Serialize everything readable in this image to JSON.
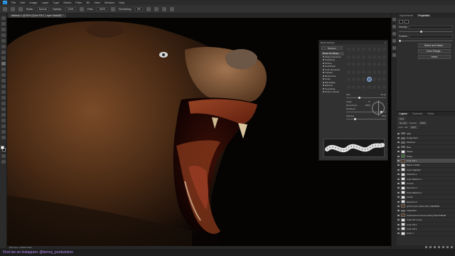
{
  "menubar": {
    "app_icon": "Ps",
    "items": [
      "File",
      "Edit",
      "Image",
      "Layer",
      "Type",
      "Select",
      "Filter",
      "3D",
      "View",
      "Window",
      "Help"
    ]
  },
  "options_bar": {
    "mode_label": "Mode:",
    "mode_value": "Normal",
    "opacity_label": "Opacity:",
    "opacity_value": "100%",
    "flow_label": "Flow:",
    "flow_value": "100%",
    "smoothing_label": "Smoothing:",
    "smoothing_value": "0%"
  },
  "document": {
    "tab_title": "tabbear-1 @ 50% (Color Fill 1, Layer Mask/8) *",
    "status": "50%     Doc: 2.90M/2.00M"
  },
  "brush_settings": {
    "title": "Brush Settings",
    "brushes_button": "Brushes",
    "sections": [
      {
        "label": "Brush Tip Shape",
        "active": true
      },
      {
        "label": "Shape Dynamics",
        "active": false
      },
      {
        "label": "Scattering",
        "active": false
      },
      {
        "label": "Texture",
        "active": false
      },
      {
        "label": "Dual Brush",
        "active": false
      },
      {
        "label": "Color Dynamics",
        "active": false
      },
      {
        "label": "Transfer",
        "active": false
      },
      {
        "label": "Brush Pose",
        "active": false
      },
      {
        "label": "Noise",
        "active": false
      },
      {
        "label": "Wet Edges",
        "active": false
      },
      {
        "label": "Build-up",
        "active": false
      },
      {
        "label": "Smoothing",
        "active": false
      },
      {
        "label": "Protect Texture",
        "active": false
      }
    ],
    "size_label": "Size",
    "size_value": "53 px",
    "angle_label": "Angle:",
    "angle_value": "0°",
    "roundness_label": "Roundness:",
    "roundness_value": "100%",
    "hardness_label": "Hardness",
    "spacing_label": "Spacing",
    "spacing_value": "25%"
  },
  "properties": {
    "tabs": [
      "Adjustments",
      "Properties"
    ],
    "rows": [
      "Density",
      "Feather"
    ],
    "buttons": [
      "Select and Mask...",
      "Color Range...",
      "Invert"
    ]
  },
  "layers": {
    "tabs": [
      "Layers",
      "Channels",
      "Paths"
    ],
    "kind_label": "Kind",
    "blend_mode": "Normal",
    "opacity_label": "Opacity:",
    "opacity_value": "100%",
    "lock_label": "Lock:",
    "fill_label": "Fill:",
    "fill_value": "100%",
    "items": [
      {
        "name": "HBA",
        "thumb": "folder",
        "selected": false
      },
      {
        "name": "Dodge Burn",
        "thumb": "folder",
        "selected": false
      },
      {
        "name": "Shadows",
        "thumb": "folder",
        "selected": false
      },
      {
        "name": "Bear",
        "thumb": "folder",
        "selected": false
      },
      {
        "name": "Shape",
        "thumb": "white",
        "selected": false
      },
      {
        "name": "Sharp",
        "thumb": "green",
        "selected": false
      },
      {
        "name": "Color Fill 1",
        "thumb": "bear",
        "selected": true
      },
      {
        "name": "Black & White",
        "thumb": "white",
        "selected": false
      },
      {
        "name": "Color Highlight",
        "thumb": "white",
        "selected": false
      },
      {
        "name": "Selective 1",
        "thumb": "white",
        "selected": false
      },
      {
        "name": "Color Balance 1",
        "thumb": "white",
        "selected": false
      },
      {
        "name": "Curves",
        "thumb": "white",
        "selected": false
      },
      {
        "name": "Exposure 1",
        "thumb": "white",
        "selected": false
      },
      {
        "name": "Color Balance 2",
        "thumb": "white",
        "selected": false
      },
      {
        "name": "Levels",
        "thumb": "white",
        "selected": false
      },
      {
        "name": "Exposure 2",
        "thumb": "white",
        "selected": false
      },
      {
        "name": "grizzly bear (effect) 3D-1 RENDER",
        "thumb": "bear",
        "selected": false
      },
      {
        "name": "Inspiration",
        "thumb": "folder",
        "selected": false
      },
      {
        "name": "bearbusiness Forest staring PHOTOBOM",
        "thumb": "bear",
        "selected": false
      },
      {
        "name": "Color Fill 1 copy",
        "thumb": "white",
        "selected": false
      },
      {
        "name": "Color Fill 2",
        "thumb": "white",
        "selected": false
      },
      {
        "name": "Color Fill 3",
        "thumb": "white",
        "selected": false
      },
      {
        "name": "Color 4",
        "thumb": "white",
        "selected": false
      }
    ]
  },
  "footer": {
    "instagram": "Find me on Instagram: @benny_productions"
  },
  "colors": {
    "accent": "#31a8ff",
    "canvas_bg": "#050403",
    "instagram_text": "#b98cf3"
  }
}
